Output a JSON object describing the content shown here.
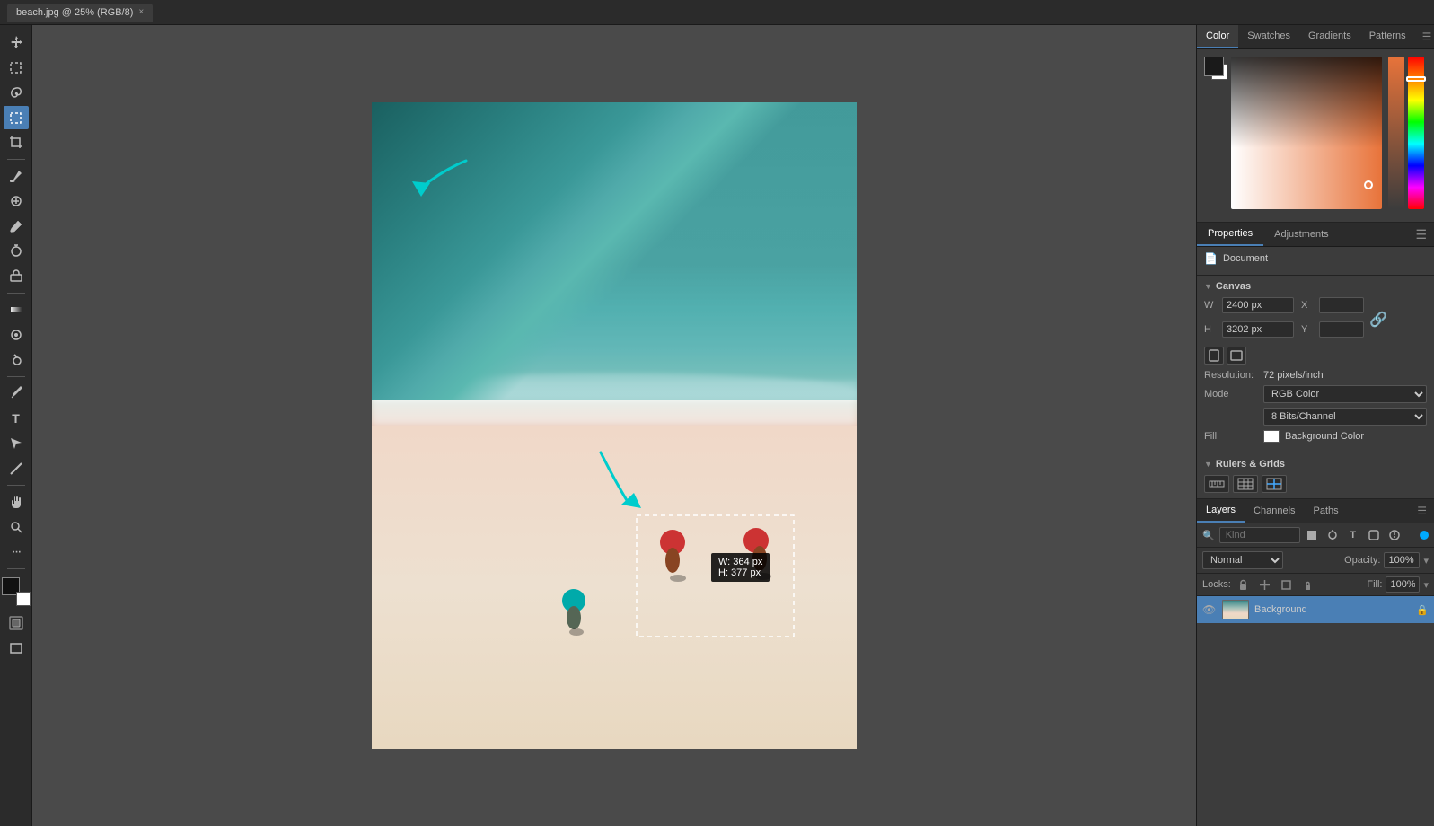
{
  "titleBar": {
    "tab": "beach.jpg @ 25% (RGB/8)",
    "closeLabel": "×"
  },
  "toolbar": {
    "tools": [
      {
        "name": "move",
        "icon": "✛",
        "active": false
      },
      {
        "name": "marquee-rect",
        "icon": "⬚",
        "active": false
      },
      {
        "name": "lasso",
        "icon": "⌓",
        "active": false
      },
      {
        "name": "marquee-select",
        "icon": "⊡",
        "active": true
      },
      {
        "name": "crop",
        "icon": "⊞",
        "active": false
      },
      {
        "name": "eyedropper",
        "icon": "✉",
        "active": false
      },
      {
        "name": "healing",
        "icon": "⊕",
        "active": false
      },
      {
        "name": "brush",
        "icon": "🖌",
        "active": false
      },
      {
        "name": "clone-stamp",
        "icon": "⊗",
        "active": false
      },
      {
        "name": "eraser",
        "icon": "◻",
        "active": false
      },
      {
        "name": "gradient",
        "icon": "◱",
        "active": false
      },
      {
        "name": "blur",
        "icon": "◎",
        "active": false
      },
      {
        "name": "dodge",
        "icon": "◑",
        "active": false
      },
      {
        "name": "pen",
        "icon": "✒",
        "active": false
      },
      {
        "name": "type",
        "icon": "T",
        "active": false
      },
      {
        "name": "path-select",
        "icon": "↖",
        "active": false
      },
      {
        "name": "line",
        "icon": "╱",
        "active": false
      },
      {
        "name": "hand",
        "icon": "✋",
        "active": false
      },
      {
        "name": "zoom",
        "icon": "🔍",
        "active": false
      },
      {
        "name": "more",
        "icon": "…",
        "active": false
      }
    ]
  },
  "colorPanel": {
    "title": "Color",
    "tabs": [
      "Color",
      "Swatches",
      "Gradients",
      "Patterns"
    ]
  },
  "propertiesPanel": {
    "title": "Properties",
    "adjTitle": "Adjustments",
    "documentLabel": "Document",
    "canvasLabel": "Canvas",
    "widthLabel": "W",
    "heightLabel": "H",
    "widthValue": "2400 px",
    "heightValue": "3202 px",
    "xLabel": "X",
    "yLabel": "Y",
    "xValue": "",
    "yValue": "",
    "resolutionLabel": "Resolution:",
    "resolutionValue": "72 pixels/inch",
    "modeLabel": "Mode",
    "modeValue": "RGB Color",
    "bitsLabel": "8 Bits/Channel",
    "fillLabel": "Fill",
    "fillValue": "Background Color",
    "rulersGridsLabel": "Rulers & Grids"
  },
  "layersPanel": {
    "title": "Layers",
    "channelsTab": "Channels",
    "pathsTab": "Paths",
    "searchPlaceholder": "Kind",
    "blendMode": "Normal",
    "opacityLabel": "Opacity:",
    "opacityValue": "100%",
    "lockLabel": "Locks:",
    "fillLayerLabel": "Fill:",
    "fillLayerValue": "100%",
    "layers": [
      {
        "name": "Background",
        "visible": true,
        "locked": true,
        "selected": false
      }
    ]
  },
  "canvas": {
    "selectionWidth": "W: 364 px",
    "selectionHeight": "H: 377 px",
    "arrows": {
      "topArrow": "cyan arrow pointing right-down to marquee tool",
      "bottomArrow": "cyan arrow pointing down-right to beach selection"
    }
  }
}
